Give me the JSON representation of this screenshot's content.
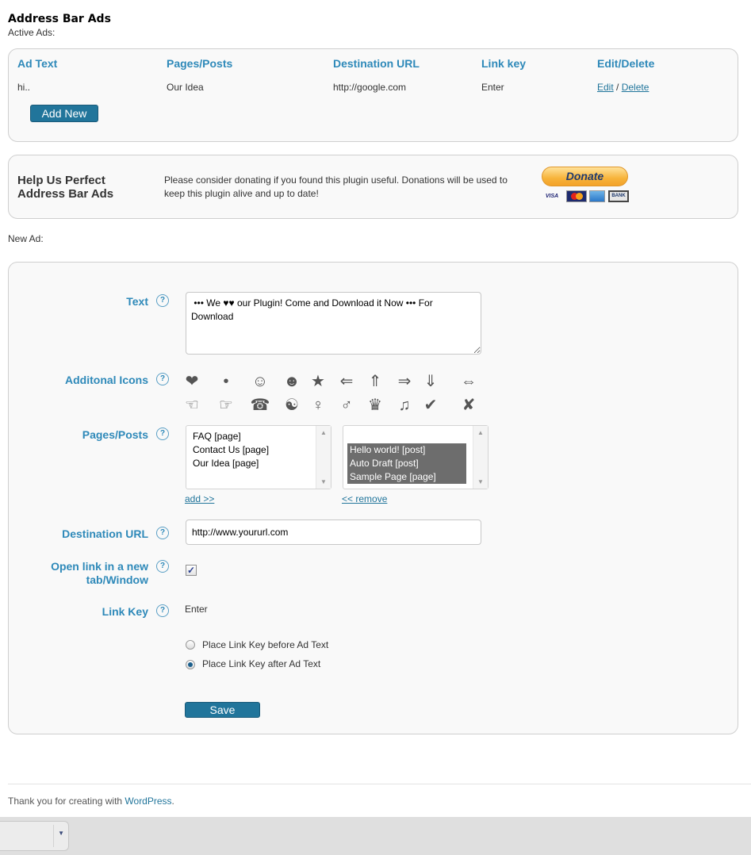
{
  "header": {
    "title": "Address Bar Ads",
    "subtitle": "Active Ads:"
  },
  "active_ads": {
    "columns": [
      "Ad Text",
      "Pages/Posts",
      "Destination URL",
      "Link key",
      "Edit/Delete"
    ],
    "rows": [
      {
        "ad_text": "hi..",
        "pages": "Our Idea",
        "url": "http://google.com",
        "link_key": "Enter",
        "edit": "Edit",
        "separator": "/",
        "delete": "Delete"
      }
    ],
    "add_new_label": "Add New"
  },
  "donate": {
    "title": "Help Us Perfect Address Bar Ads",
    "text": "Please consider donating if you found this plugin useful. Donations will be used to keep this plugin alive and up to date!",
    "button_label": "Donate",
    "cards": [
      "VISA",
      "MC",
      "AMEX",
      "BANK"
    ]
  },
  "new_ad": {
    "section_label": "New Ad:",
    "text_label": "Text",
    "text_value": " ••• We ♥♥ our Plugin! Come and Download it Now ••• For Download",
    "icons_label": "Additonal Icons",
    "icons_row1": [
      {
        "name": "heart-icon",
        "glyph": "❤"
      },
      {
        "name": "bullet-icon",
        "glyph": "•"
      },
      {
        "name": "smiley-icon",
        "glyph": "☺"
      },
      {
        "name": "black-smiley-icon",
        "glyph": "☻"
      },
      {
        "name": "star-icon",
        "glyph": "★"
      },
      {
        "name": "double-arrow-left-icon",
        "glyph": "⇐"
      },
      {
        "name": "double-arrow-up-icon",
        "glyph": "⇑"
      },
      {
        "name": "double-arrow-right-icon",
        "glyph": "⇒"
      },
      {
        "name": "double-arrow-down-icon",
        "glyph": "⇓"
      },
      {
        "name": "double-arrow-left-right-icon",
        "glyph": "⇔"
      }
    ],
    "icons_row2": [
      {
        "name": "pointing-left-hand-icon",
        "glyph": "☜"
      },
      {
        "name": "pointing-right-hand-icon",
        "glyph": "☞"
      },
      {
        "name": "telephone-icon",
        "glyph": "☎"
      },
      {
        "name": "yin-yang-icon",
        "glyph": "☯"
      },
      {
        "name": "female-sign-icon",
        "glyph": "♀"
      },
      {
        "name": "male-sign-icon",
        "glyph": "♂"
      },
      {
        "name": "crown-icon",
        "glyph": "♛"
      },
      {
        "name": "music-note-icon",
        "glyph": "♫"
      },
      {
        "name": "check-mark-icon",
        "glyph": "✔"
      },
      {
        "name": "x-mark-icon",
        "glyph": "✘"
      }
    ],
    "pages_label": "Pages/Posts",
    "available_pages": [
      "FAQ  [page]",
      "Contact Us  [page]",
      "Our Idea  [page]"
    ],
    "selected_pages": [
      "Hello world!  [post]",
      "Auto Draft  [post]",
      "Sample Page  [page]"
    ],
    "add_link": "add >>",
    "remove_link": "<< remove",
    "url_label": "Destination URL",
    "url_value": "http://www.yoururl.com",
    "new_tab_label": "Open link in a new tab/Window",
    "new_tab_checked": true,
    "link_key_label": "Link Key",
    "link_key_value": "Enter",
    "radio_before": "Place Link Key before Ad Text",
    "radio_after": "Place Link Key after Ad Text",
    "radio_selected": "after",
    "save_label": "Save",
    "help_glyph": "?"
  },
  "footer": {
    "text": "Thank you for creating with ",
    "link": "WordPress",
    "suffix": "."
  },
  "colors": {
    "accent": "#2e89b9",
    "button": "#21759b",
    "panel_bg": "#f9f9f9"
  }
}
